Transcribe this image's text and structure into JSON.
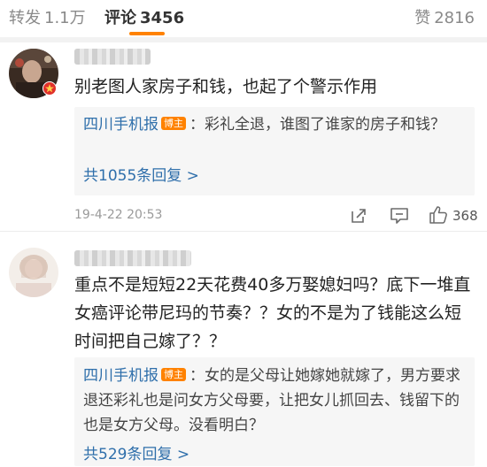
{
  "tabs": {
    "repost": {
      "label": "转发",
      "count": "1.1万"
    },
    "comment": {
      "label": "评论",
      "count": "3456"
    },
    "like": {
      "label": "赞",
      "count": "2816"
    }
  },
  "comments": [
    {
      "text": "别老图人家房子和钱，也起了个警示作用",
      "reply": {
        "author": "四川手机报",
        "badge": "博主",
        "text": "：彩礼全退，谁图了谁家的房子和钱？"
      },
      "reply_link": "共1055条回复 >",
      "timestamp": "19-4-22 20:53",
      "likes": "368"
    },
    {
      "text": "重点不是短短22天花费40多万娶媳妇吗？底下一堆直女癌评论带尼玛的节奏？？女的不是为了钱能这么短时间把自己嫁了？？",
      "reply": {
        "author": "四川手机报",
        "badge": "博主",
        "text": "：女的是父母让她嫁她就嫁了，男方要求退还彩礼也是问女方父母要，让把女儿抓回去、钱留下的也是女方父母。没看明白？"
      },
      "reply_link": "共529条回复 >"
    }
  ],
  "colors": {
    "accent": "#ff8200",
    "link": "#2f6fab",
    "badge_bg": "#ff8200",
    "reply_bg": "#f6f6f6"
  },
  "icons": [
    "vip-badge-icon",
    "share-icon",
    "reply-icon",
    "thumbs-up-icon"
  ]
}
